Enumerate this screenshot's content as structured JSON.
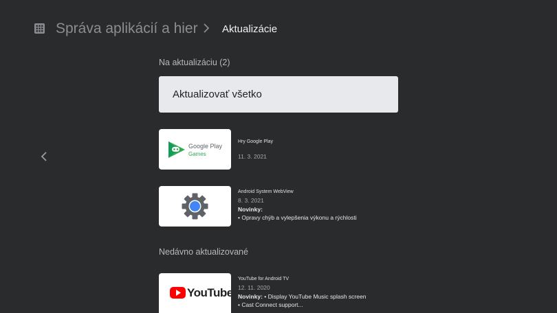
{
  "header": {
    "parent": "Správa aplikácií a hier",
    "current": "Aktualizácie"
  },
  "updates": {
    "title": "Na aktualizáciu (2)",
    "update_all_label": "Aktualizovať všetko",
    "items": [
      {
        "name": "Hry Google Play",
        "date": "11. 3. 2021",
        "logo_line1": "Google Play",
        "logo_line2": "Games"
      },
      {
        "name": "Android System WebView",
        "date": "8. 3. 2021",
        "news_label": "Novinky:",
        "news_text": "• Opravy chýb a vylepšenia výkonu a rýchlosti"
      }
    ]
  },
  "recent": {
    "title": "Nedávno aktualizované",
    "items": [
      {
        "name": "YouTube for Android TV",
        "date": "12. 11. 2020",
        "news_label": "Novinky:",
        "news_text": " • Display YouTube Music splash screen",
        "news_text2": "• Cast Connect support...",
        "logo_text": "YouTube"
      }
    ]
  },
  "colors": {
    "background": "#2a2b2d",
    "button_bg": "#e8e9ed",
    "youtube_red": "#ff0000",
    "webview_blue": "#4285f4",
    "gear_gray": "#5f6368"
  },
  "icons": {
    "apps": "grid-apps-icon",
    "separator": "chevron-right-icon",
    "back": "chevron-left-icon"
  }
}
